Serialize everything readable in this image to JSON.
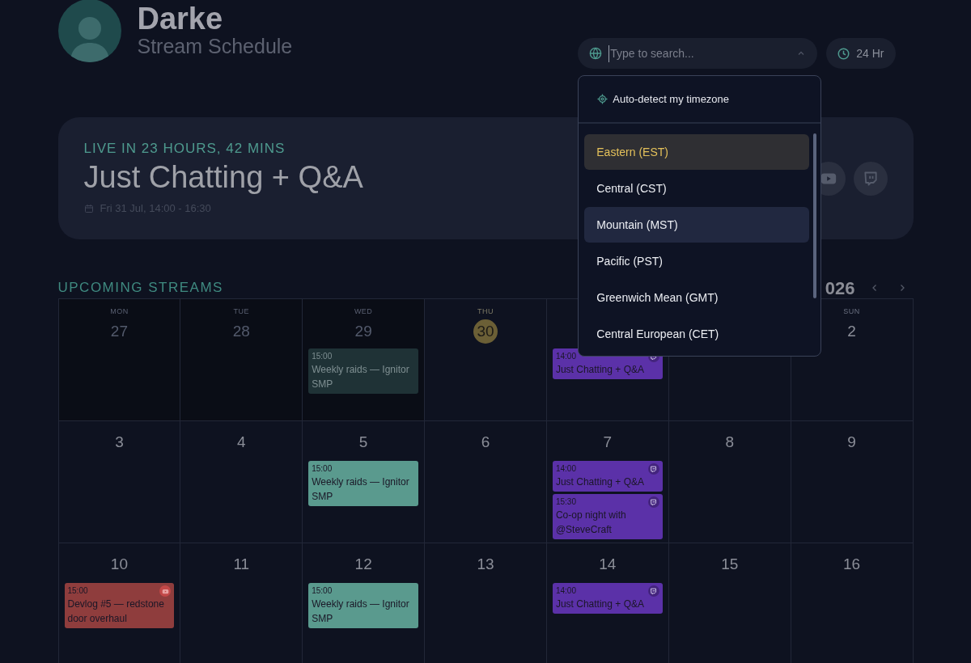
{
  "profile": {
    "name": "Darke",
    "subtitle": "Stream Schedule"
  },
  "timezone_search": {
    "placeholder": "Type to search...",
    "expanded": true
  },
  "clock_toggle": {
    "label": "24 Hr"
  },
  "timezone_menu": {
    "auto_detect": "Auto-detect my timezone",
    "options": [
      {
        "label": "Eastern (EST)",
        "selected": true,
        "highlighted": false
      },
      {
        "label": "Central (CST)",
        "selected": false,
        "highlighted": false
      },
      {
        "label": "Mountain (MST)",
        "selected": false,
        "highlighted": true
      },
      {
        "label": "Pacific (PST)",
        "selected": false,
        "highlighted": false
      },
      {
        "label": "Greenwich Mean (GMT)",
        "selected": false,
        "highlighted": false
      },
      {
        "label": "Central European (CET)",
        "selected": false,
        "highlighted": false
      }
    ]
  },
  "next_stream": {
    "countdown": "LIVE IN 23 HOURS, 42 MINS",
    "title": "Just Chatting + Q&A",
    "when": "Fri 31 Jul, 14:00 - 16:30"
  },
  "schedule": {
    "heading": "UPCOMING STREAMS",
    "month": "026",
    "weeks": [
      [
        {
          "weekday": "MON",
          "day": "27",
          "past": true,
          "today": false
        },
        {
          "weekday": "TUE",
          "day": "28",
          "past": true,
          "today": false
        },
        {
          "weekday": "WED",
          "day": "29",
          "past": true,
          "today": false,
          "events": [
            {
              "time": "15:00",
              "title": "Weekly raids — Ignitor SMP",
              "kind": "plain",
              "color": "#1f3236"
            }
          ]
        },
        {
          "weekday": "THU",
          "day": "30",
          "past": false,
          "today": true
        },
        {
          "past": false,
          "events": [
            {
              "time": "14:00",
              "title": "Just Chatting + Q&A",
              "kind": "twitch",
              "color": "#5b31a8"
            }
          ]
        },
        {
          "past": false
        },
        {
          "weekday": "SUN",
          "day": "2",
          "past": false,
          "today": false
        }
      ],
      [
        {
          "day": "3",
          "past": false,
          "today": false
        },
        {
          "day": "4",
          "past": false,
          "today": false
        },
        {
          "day": "5",
          "past": false,
          "today": false,
          "events": [
            {
              "time": "15:00",
              "title": "Weekly raids — Ignitor SMP",
              "kind": "plain",
              "color": "#5a9a8e"
            }
          ]
        },
        {
          "day": "6",
          "past": false,
          "today": false
        },
        {
          "day": "7",
          "past": false,
          "today": false,
          "events": [
            {
              "time": "14:00",
              "title": "Just Chatting + Q&A",
              "kind": "twitch",
              "color": "#5b31a8"
            },
            {
              "time": "15:30",
              "title": "Co-op night with @SteveCraft",
              "kind": "twitch",
              "color": "#5b31a8"
            }
          ]
        },
        {
          "day": "8",
          "past": false,
          "today": false
        },
        {
          "day": "9",
          "past": false,
          "today": false
        }
      ],
      [
        {
          "day": "10",
          "past": false,
          "today": false,
          "events": [
            {
              "time": "15:00",
              "title": "Devlog #5 — redstone door overhaul",
              "kind": "youtube",
              "color": "#8f3d3d"
            }
          ]
        },
        {
          "day": "11",
          "past": false,
          "today": false
        },
        {
          "day": "12",
          "past": false,
          "today": false,
          "events": [
            {
              "time": "15:00",
              "title": "Weekly raids — Ignitor SMP",
              "kind": "plain",
              "color": "#5a9a8e"
            }
          ]
        },
        {
          "day": "13",
          "past": false,
          "today": false
        },
        {
          "day": "14",
          "past": false,
          "today": false,
          "events": [
            {
              "time": "14:00",
              "title": "Just Chatting + Q&A",
              "kind": "twitch",
              "color": "#5b31a8"
            }
          ]
        },
        {
          "day": "15",
          "past": false,
          "today": false
        },
        {
          "day": "16",
          "past": false,
          "today": false
        }
      ]
    ]
  }
}
